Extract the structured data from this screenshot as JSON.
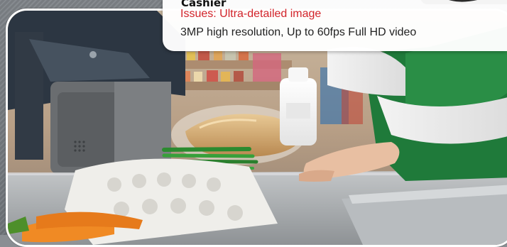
{
  "caption": {
    "title": "Cashier",
    "issue": "Issues: Ultra-detailed image",
    "description": "3MP high resolution, Up to 60fps Full HD video"
  },
  "colors": {
    "issue_text": "#d2232a",
    "card_background": "#ffffff",
    "frame_border": "#ffffff",
    "apron_green": "#1f7a3a"
  },
  "icons": {
    "camera": "camera-icon"
  }
}
